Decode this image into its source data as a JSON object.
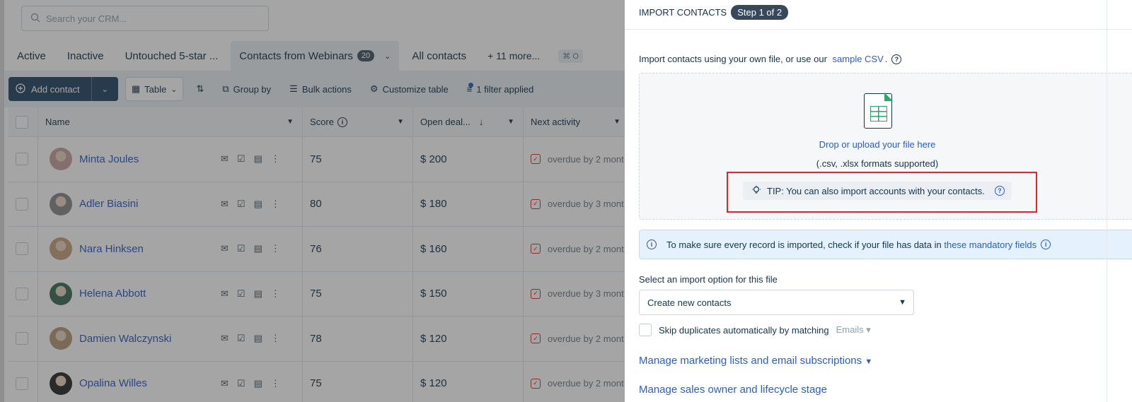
{
  "search": {
    "placeholder": "Search your CRM..."
  },
  "tabs": [
    {
      "label": "Active"
    },
    {
      "label": "Inactive"
    },
    {
      "label": "Untouched 5-star ..."
    },
    {
      "label": "Contacts from Webinars",
      "count": "20"
    },
    {
      "label": "All contacts"
    },
    {
      "label": "11 more..."
    }
  ],
  "shortcut": "⌘ O",
  "toolbar": {
    "add": "Add contact",
    "view": "Table",
    "group": "Group by",
    "bulk": "Bulk actions",
    "customize": "Customize table",
    "filter": "1 filter applied"
  },
  "columns": {
    "name": "Name",
    "score": "Score",
    "deal": "Open deal...",
    "activity": "Next activity"
  },
  "rows": [
    {
      "name": "Minta Joules",
      "score": "75",
      "deal": "$ 200",
      "activity": "overdue by 2 mont"
    },
    {
      "name": "Adler Biasini",
      "score": "80",
      "deal": "$ 180",
      "activity": "overdue by 3 mont"
    },
    {
      "name": "Nara Hinksen",
      "score": "76",
      "deal": "$ 160",
      "activity": "overdue by 2 mont"
    },
    {
      "name": "Helena Abbott",
      "score": "75",
      "deal": "$ 150",
      "activity": "overdue by 3 mont"
    },
    {
      "name": "Damien Walczynski",
      "score": "78",
      "deal": "$ 120",
      "activity": "overdue by 2 mont"
    },
    {
      "name": "Opalina Willes",
      "score": "75",
      "deal": "$ 120",
      "activity": "overdue by 2 mont"
    }
  ],
  "panel": {
    "title": "IMPORT CONTACTS",
    "step": "Step 1 of 2",
    "intro_text": "Import contacts using your own file, or use our",
    "intro_link": "sample CSV",
    "intro_end": ".",
    "drop_title": "Drop or upload your file here",
    "drop_sub": "(.csv, .xlsx formats supported)",
    "tip": "TIP: You can also import accounts with your contacts.",
    "info_text": "To make sure every record is imported, check if your file has data in",
    "info_link": "these mandatory fields",
    "select_label": "Select an import option for this file",
    "select_value": "Create new contacts",
    "skip_label": "Skip duplicates automatically by matching",
    "skip_value": "Emails",
    "manage_lists": "Manage marketing lists and email subscriptions",
    "manage_owner": "Manage sales owner and lifecycle stage"
  },
  "colors": {
    "accent": "#2c5cc5",
    "primary_button": "#264966",
    "tip_highlight": "#e0262b"
  }
}
